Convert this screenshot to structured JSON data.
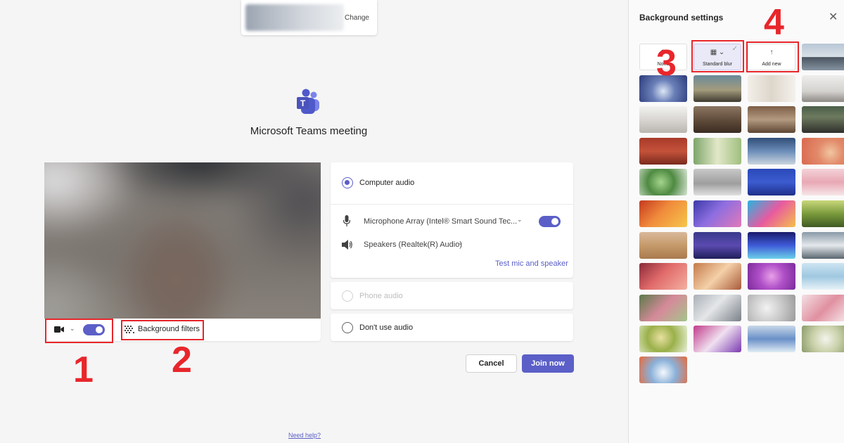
{
  "account": {
    "change_label": "Change"
  },
  "meeting": {
    "title": "Microsoft Teams meeting"
  },
  "video_bar": {
    "background_filters_label": "Background filters"
  },
  "audio": {
    "computer_audio": "Computer audio",
    "microphone": "Microphone Array (Intel® Smart Sound Tec...",
    "speakers": "Speakers (Realtek(R) Audio)",
    "test_link": "Test mic and speaker",
    "phone_audio": "Phone audio",
    "no_audio": "Don't use audio"
  },
  "buttons": {
    "cancel": "Cancel",
    "join": "Join now"
  },
  "help_link": "Need help?",
  "panel": {
    "title": "Background settings",
    "none_label": "None",
    "blur_label": "Standard blur",
    "add_label": "Add new"
  },
  "annotations": [
    "1",
    "2",
    "3",
    "4"
  ],
  "colors": {
    "accent": "#5b5fc7",
    "annotation": "#e8262b"
  }
}
